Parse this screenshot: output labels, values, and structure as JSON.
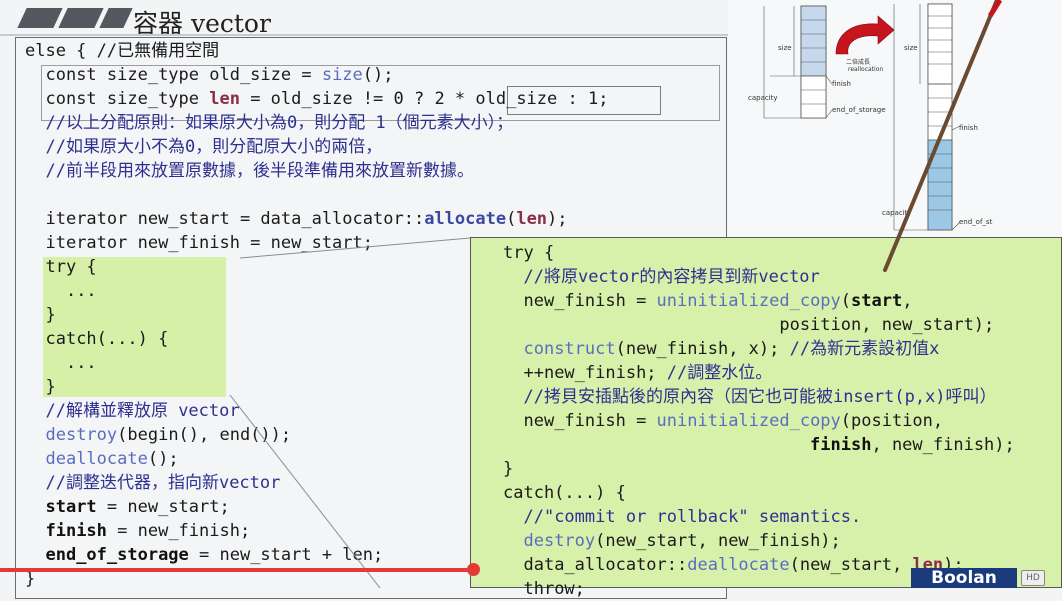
{
  "title": "容器 vector",
  "left_code": {
    "else_line": "else { //已無備用空間",
    "l_const1": "const size_type old_size = ",
    "l_size_fn": "size",
    "l_const1_tail": "();",
    "l_const2_a": "const size_type ",
    "l_const2_len": "len",
    "l_const2_b": " = old_size != 0 ? ",
    "l_const2_expr": "2 * old_size",
    "l_const2_c": " : 1;",
    "c1": "//以上分配原則：如果原大小為0，則分配 1（個元素大小）；",
    "c2": "//如果原大小不為0，則分配原大小的兩倍，",
    "c3": "//前半段用來放置原數據，後半段準備用來放置新數據。",
    "alloc_a": "iterator new_start = data_allocator::",
    "alloc_fn": "allocate",
    "alloc_b": "(",
    "alloc_len": "len",
    "alloc_c": ");",
    "finish_line": "iterator new_finish = new_start;",
    "try_line": "try {",
    "dots1": "...",
    "close1": "}",
    "catch_line": "catch(...) {",
    "dots2": "...",
    "close2": "}",
    "c4": "//解構並釋放原 vector",
    "destroy_fn": "destroy",
    "destroy_tail": "(begin(), end());",
    "dealloc_fn": "deallocate",
    "dealloc_tail": "();",
    "c5": "//調整迭代器，指向新vector",
    "start_kw": "start",
    "start_tail": " = new_start;",
    "finish_kw": "finish",
    "finish_tail": " = new_finish;",
    "eos_kw": "end_of_storage",
    "eos_tail": " = new_start + len;",
    "final_close": "}"
  },
  "right_code": {
    "try_line": "try {",
    "c1": "//將原vector的內容拷貝到新vector",
    "r1_a": "new_finish = ",
    "r1_fn": "uninitialized_copy",
    "r1_b": "(",
    "r1_start": "start",
    "r1_c": ",",
    "r2": "position, new_start);",
    "r3_fn": "construct",
    "r3_b": "(new_finish, x); ",
    "r3_c": "//為新元素設初值x",
    "r4_a": "++new_finish; ",
    "r4_c": "//調整水位。",
    "c2": "//拷貝安插點後的原內容（因它也可能被insert(p,x)呼叫）",
    "r5_a": "new_finish = ",
    "r5_fn": "uninitialized_copy",
    "r5_b": "(position,",
    "r6_finish": "finish",
    "r6_b": ", new_finish);",
    "close1": "}",
    "catch_line": "catch(...) {",
    "c3": "//\"commit or rollback\" semantics.",
    "r7_fn": "destroy",
    "r7_b": "(new_start, new_finish);",
    "r8_a": "data_allocator::",
    "r8_fn": "deallocate",
    "r8_b": "(new_start, ",
    "r8_len": "len",
    "r8_c": ");",
    "r9": "throw;"
  },
  "diagram": {
    "size_label_1": "size",
    "capacity_label_1": "capacity",
    "finish_label_1": "finish",
    "eos_label_1": "end_of_storage",
    "arrow_caption_1": "二倍成長",
    "arrow_caption_2": "reallocation",
    "size_label_2": "size",
    "finish_label_2": "finish",
    "capacity_label_2": "capacity",
    "eos_label_2": "end_of_st"
  },
  "player": {
    "progress": 0.445,
    "logo": "Boolan",
    "hd_badge": "HD"
  },
  "colors": {
    "comment": "#2e3090",
    "function": "#5a6ec0",
    "len_highlight": "#8c2c46",
    "highlight_green": "#d7f0aa",
    "progress_red": "#e53935"
  }
}
